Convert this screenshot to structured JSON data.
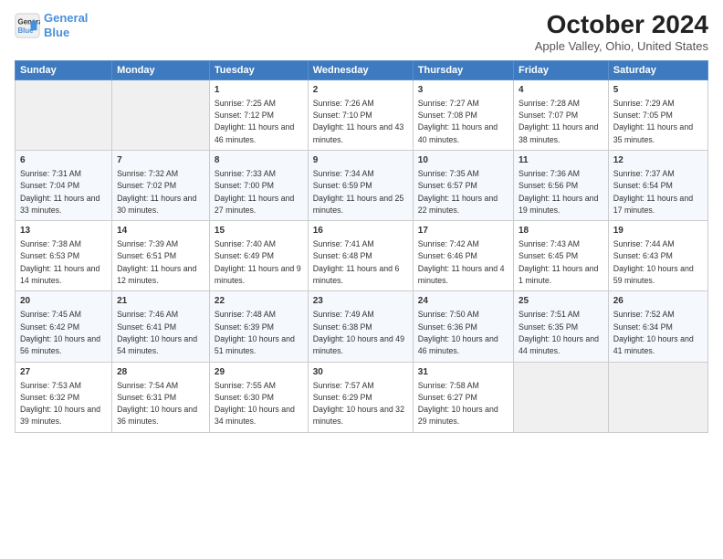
{
  "header": {
    "logo_line1": "General",
    "logo_line2": "Blue",
    "title": "October 2024",
    "subtitle": "Apple Valley, Ohio, United States"
  },
  "days_of_week": [
    "Sunday",
    "Monday",
    "Tuesday",
    "Wednesday",
    "Thursday",
    "Friday",
    "Saturday"
  ],
  "weeks": [
    [
      {
        "day": "",
        "empty": true
      },
      {
        "day": "",
        "empty": true
      },
      {
        "day": "1",
        "sunrise": "7:25 AM",
        "sunset": "7:12 PM",
        "daylight": "11 hours and 46 minutes."
      },
      {
        "day": "2",
        "sunrise": "7:26 AM",
        "sunset": "7:10 PM",
        "daylight": "11 hours and 43 minutes."
      },
      {
        "day": "3",
        "sunrise": "7:27 AM",
        "sunset": "7:08 PM",
        "daylight": "11 hours and 40 minutes."
      },
      {
        "day": "4",
        "sunrise": "7:28 AM",
        "sunset": "7:07 PM",
        "daylight": "11 hours and 38 minutes."
      },
      {
        "day": "5",
        "sunrise": "7:29 AM",
        "sunset": "7:05 PM",
        "daylight": "11 hours and 35 minutes."
      }
    ],
    [
      {
        "day": "6",
        "sunrise": "7:31 AM",
        "sunset": "7:04 PM",
        "daylight": "11 hours and 33 minutes."
      },
      {
        "day": "7",
        "sunrise": "7:32 AM",
        "sunset": "7:02 PM",
        "daylight": "11 hours and 30 minutes."
      },
      {
        "day": "8",
        "sunrise": "7:33 AM",
        "sunset": "7:00 PM",
        "daylight": "11 hours and 27 minutes."
      },
      {
        "day": "9",
        "sunrise": "7:34 AM",
        "sunset": "6:59 PM",
        "daylight": "11 hours and 25 minutes."
      },
      {
        "day": "10",
        "sunrise": "7:35 AM",
        "sunset": "6:57 PM",
        "daylight": "11 hours and 22 minutes."
      },
      {
        "day": "11",
        "sunrise": "7:36 AM",
        "sunset": "6:56 PM",
        "daylight": "11 hours and 19 minutes."
      },
      {
        "day": "12",
        "sunrise": "7:37 AM",
        "sunset": "6:54 PM",
        "daylight": "11 hours and 17 minutes."
      }
    ],
    [
      {
        "day": "13",
        "sunrise": "7:38 AM",
        "sunset": "6:53 PM",
        "daylight": "11 hours and 14 minutes."
      },
      {
        "day": "14",
        "sunrise": "7:39 AM",
        "sunset": "6:51 PM",
        "daylight": "11 hours and 12 minutes."
      },
      {
        "day": "15",
        "sunrise": "7:40 AM",
        "sunset": "6:49 PM",
        "daylight": "11 hours and 9 minutes."
      },
      {
        "day": "16",
        "sunrise": "7:41 AM",
        "sunset": "6:48 PM",
        "daylight": "11 hours and 6 minutes."
      },
      {
        "day": "17",
        "sunrise": "7:42 AM",
        "sunset": "6:46 PM",
        "daylight": "11 hours and 4 minutes."
      },
      {
        "day": "18",
        "sunrise": "7:43 AM",
        "sunset": "6:45 PM",
        "daylight": "11 hours and 1 minute."
      },
      {
        "day": "19",
        "sunrise": "7:44 AM",
        "sunset": "6:43 PM",
        "daylight": "10 hours and 59 minutes."
      }
    ],
    [
      {
        "day": "20",
        "sunrise": "7:45 AM",
        "sunset": "6:42 PM",
        "daylight": "10 hours and 56 minutes."
      },
      {
        "day": "21",
        "sunrise": "7:46 AM",
        "sunset": "6:41 PM",
        "daylight": "10 hours and 54 minutes."
      },
      {
        "day": "22",
        "sunrise": "7:48 AM",
        "sunset": "6:39 PM",
        "daylight": "10 hours and 51 minutes."
      },
      {
        "day": "23",
        "sunrise": "7:49 AM",
        "sunset": "6:38 PM",
        "daylight": "10 hours and 49 minutes."
      },
      {
        "day": "24",
        "sunrise": "7:50 AM",
        "sunset": "6:36 PM",
        "daylight": "10 hours and 46 minutes."
      },
      {
        "day": "25",
        "sunrise": "7:51 AM",
        "sunset": "6:35 PM",
        "daylight": "10 hours and 44 minutes."
      },
      {
        "day": "26",
        "sunrise": "7:52 AM",
        "sunset": "6:34 PM",
        "daylight": "10 hours and 41 minutes."
      }
    ],
    [
      {
        "day": "27",
        "sunrise": "7:53 AM",
        "sunset": "6:32 PM",
        "daylight": "10 hours and 39 minutes."
      },
      {
        "day": "28",
        "sunrise": "7:54 AM",
        "sunset": "6:31 PM",
        "daylight": "10 hours and 36 minutes."
      },
      {
        "day": "29",
        "sunrise": "7:55 AM",
        "sunset": "6:30 PM",
        "daylight": "10 hours and 34 minutes."
      },
      {
        "day": "30",
        "sunrise": "7:57 AM",
        "sunset": "6:29 PM",
        "daylight": "10 hours and 32 minutes."
      },
      {
        "day": "31",
        "sunrise": "7:58 AM",
        "sunset": "6:27 PM",
        "daylight": "10 hours and 29 minutes."
      },
      {
        "day": "",
        "empty": true
      },
      {
        "day": "",
        "empty": true
      }
    ]
  ]
}
